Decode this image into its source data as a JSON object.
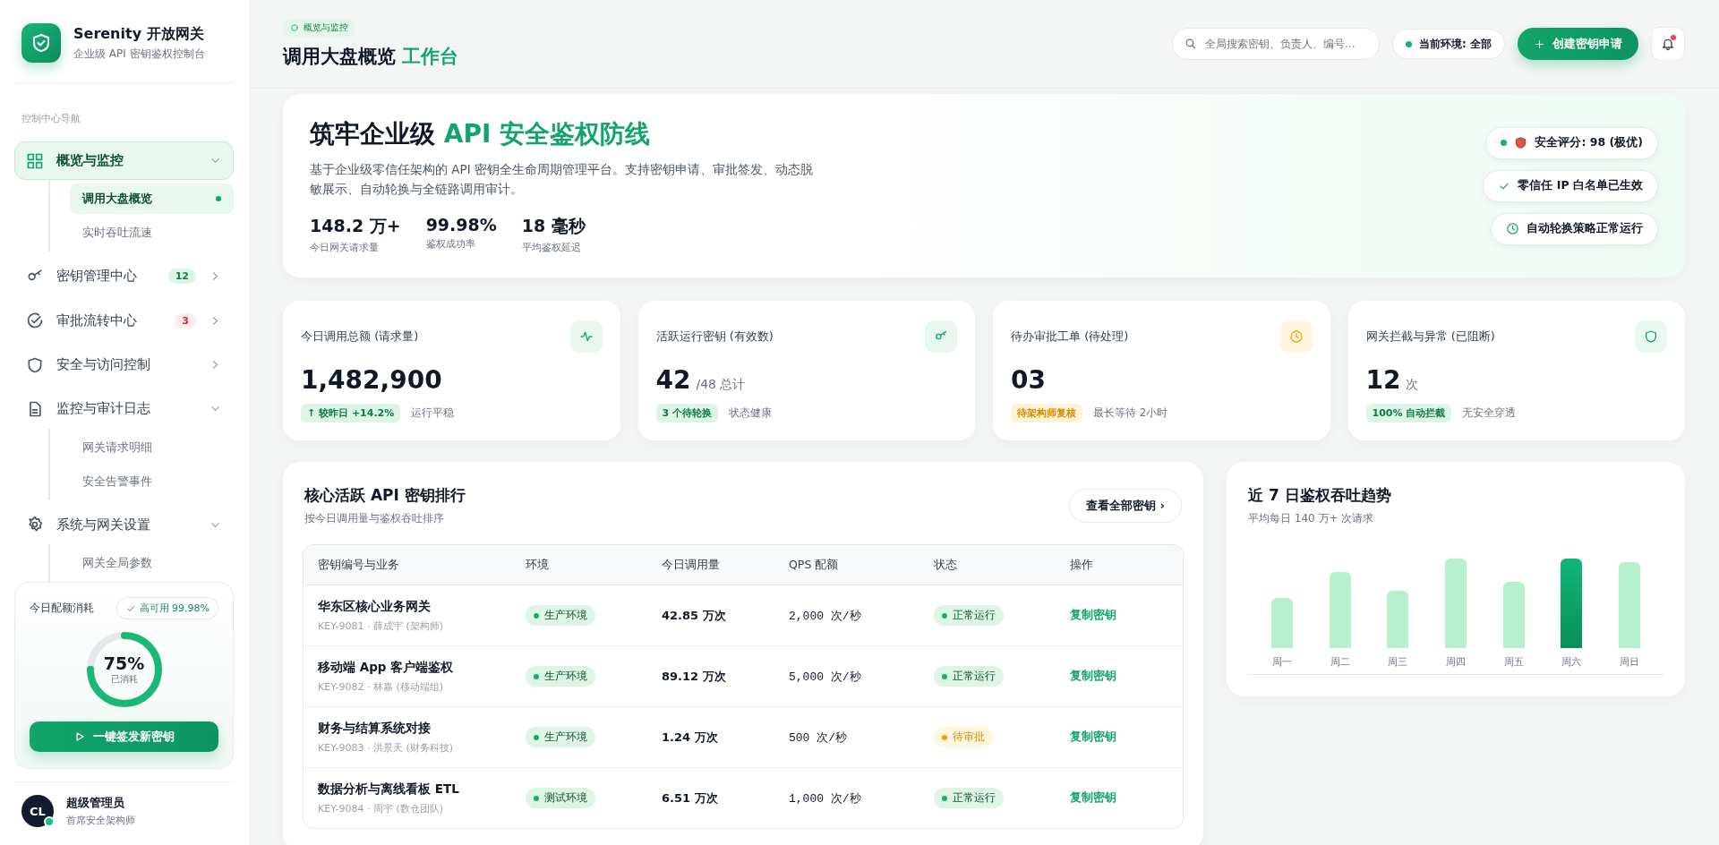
{
  "brand": {
    "name": "Serenity 开放网关",
    "tagline": "企业级 API 密钥鉴权控制台"
  },
  "nav_label": "控制中心导航",
  "nav": [
    {
      "label": "概览与监控",
      "selected": true,
      "expanded": true,
      "children": [
        {
          "label": "调用大盘概览",
          "selected": true
        },
        {
          "label": "实时吞吐流速",
          "selected": false
        }
      ]
    },
    {
      "label": "密钥管理中心",
      "selected": false,
      "expanded": false,
      "badge": {
        "text": "12",
        "kind": "info"
      }
    },
    {
      "label": "审批流转中心",
      "selected": false,
      "expanded": false,
      "badge": {
        "text": "3",
        "kind": "alert"
      }
    },
    {
      "label": "安全与访问控制",
      "selected": false,
      "expanded": false
    },
    {
      "label": "监控与审计日志",
      "selected": false,
      "expanded": true,
      "children": [
        {
          "label": "网关请求明细",
          "selected": false
        },
        {
          "label": "安全告警事件",
          "selected": false
        }
      ]
    },
    {
      "label": "系统与网关设置",
      "selected": false,
      "expanded": true,
      "children": [
        {
          "label": "网关全局参数",
          "selected": false
        }
      ]
    }
  ],
  "quota": {
    "title": "今日配额消耗",
    "availability": "高可用 99.98%",
    "level": 0.75,
    "percent": "75%",
    "caption": "已消耗",
    "button": "一键签发新密钥"
  },
  "user": {
    "initials": "CL",
    "name": "超级管理员",
    "role": "首席安全架构师",
    "online": true
  },
  "header": {
    "breadcrumb": "概览与监控",
    "title": "调用大盘概览",
    "title_highlight": "工作台",
    "search_placeholder": "全局搜索密钥、负责人、编号...",
    "environment": "当前环境: 全部",
    "create_button": "创建密钥申请",
    "notification_dot": true
  },
  "hero": {
    "title": "筑牢企业级",
    "title_highlight": "API 安全鉴权防线",
    "description": "基于企业级零信任架构的 API 密钥全生命周期管理平台。支持密钥申请、审批签发、动态脱敏展示、自动轮换与全链路调用审计。",
    "stats": [
      {
        "value": "148.2 万+",
        "label": "今日网关请求量"
      },
      {
        "value": "99.98%",
        "label": "鉴权成功率"
      },
      {
        "value": "18 毫秒",
        "label": "平均鉴权延迟"
      }
    ],
    "badges": [
      {
        "kind": "score",
        "label": "安全评分: 98 (极优)"
      },
      {
        "kind": "check",
        "label": "零信任 IP 白名单已生效"
      },
      {
        "kind": "clock",
        "label": "自动轮换策略正常运行"
      }
    ]
  },
  "stat_cards": [
    {
      "title": "今日调用总额 (请求量)",
      "value": "1,482,900",
      "chip": {
        "text": "↑ 较昨日 +14.2%",
        "kind": "good"
      },
      "note": "运行平稳"
    },
    {
      "title": "活跃运行密钥 (有效数)",
      "value": "42",
      "suffix": "/48 总计",
      "chip": {
        "text": "3 个待轮换",
        "kind": "good"
      },
      "note": "状态健康"
    },
    {
      "title": "待办审批工单 (待处理)",
      "value": "03",
      "chip": {
        "text": "待架构师复核",
        "kind": "warn"
      },
      "note": "最长等待 2小时"
    },
    {
      "title": "网关拦截与异常 (已阻断)",
      "value": "12",
      "suffix": "次",
      "chip": {
        "text": "100% 自动拦截",
        "kind": "good"
      },
      "note": "无安全穿透"
    }
  ],
  "keys_table": {
    "title": "核心活跃 API 密钥排行",
    "subtitle": "按今日调用量与鉴权吞吐排序",
    "view_all": "查看全部密钥 ›",
    "columns": [
      "密钥编号与业务",
      "环境",
      "今日调用量",
      "QPS 配额",
      "状态",
      "操作"
    ],
    "rows": [
      {
        "name": "华东区核心业务网关",
        "meta": "KEY-9081 · 薛成宇 (架构师)",
        "env": "生产环境",
        "calls": "42.85 万次",
        "qps": "2,000 次/秒",
        "status": {
          "label": "正常运行",
          "kind": "ok"
        },
        "action": "复制密钥"
      },
      {
        "name": "移动端 App 客户端鉴权",
        "meta": "KEY-9082 · 林嘉 (移动端组)",
        "env": "生产环境",
        "calls": "89.12 万次",
        "qps": "5,000 次/秒",
        "status": {
          "label": "正常运行",
          "kind": "ok"
        },
        "action": "复制密钥"
      },
      {
        "name": "财务与结算系统对接",
        "meta": "KEY-9083 · 洪景天 (财务科技)",
        "env": "生产环境",
        "calls": "1.24 万次",
        "qps": "500 次/秒",
        "status": {
          "label": "待审批",
          "kind": "pending"
        },
        "action": "复制密钥"
      },
      {
        "name": "数据分析与离线看板 ETL",
        "meta": "KEY-9084 · 周宇 (数仓团队)",
        "env": "测试环境",
        "calls": "6.51 万次",
        "qps": "1,000 次/秒",
        "status": {
          "label": "正常运行",
          "kind": "ok"
        },
        "action": "复制密钥"
      }
    ]
  },
  "trend": {
    "title": "近 7 日鉴权吞吐趋势",
    "subtitle": "平均每日 140 万+ 次请求",
    "days": [
      {
        "label": "周一",
        "selected": false
      },
      {
        "label": "周二",
        "selected": false
      },
      {
        "label": "周三",
        "selected": false
      },
      {
        "label": "周四",
        "selected": false
      },
      {
        "label": "周五",
        "selected": false
      },
      {
        "label": "周六",
        "selected": true
      },
      {
        "label": "周日",
        "selected": false
      }
    ]
  }
}
